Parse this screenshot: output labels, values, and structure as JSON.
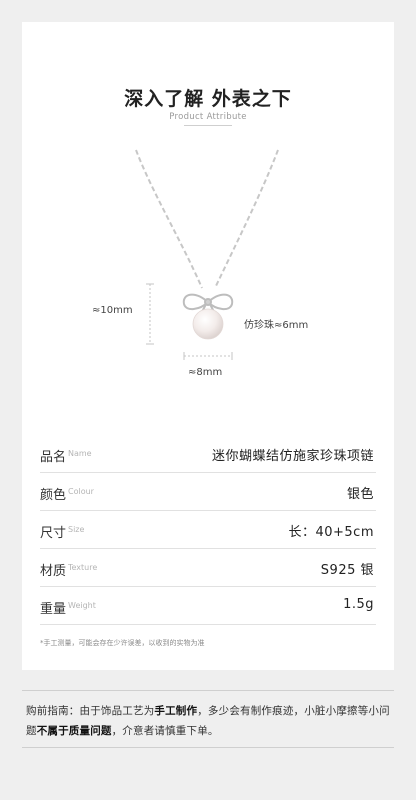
{
  "header": {
    "title": "深入了解 外表之下",
    "subtitle": "Product Attribute"
  },
  "dimensions": {
    "height_label": "≈10mm",
    "pearl_label": "仿珍珠≈6mm",
    "width_label": "≈8mm"
  },
  "attributes": [
    {
      "label": "品名",
      "label_en": "Name",
      "value": "迷你蝴蝶结仿施家珍珠项链"
    },
    {
      "label": "颜色",
      "label_en": "Colour",
      "value": "银色"
    },
    {
      "label": "尺寸",
      "label_en": "Size",
      "value": "长：40+5cm"
    },
    {
      "label": "材质",
      "label_en": "Texture",
      "value": "S925 银"
    },
    {
      "label": "重量",
      "label_en": "Weight",
      "value": "1.5g"
    }
  ],
  "footnote": "*手工测量，可能会存在少许误差，以收到的实物为准",
  "notice": {
    "part1": "购前指南：由于饰品工艺为",
    "bold1": "手工制作",
    "part2": "，多少会有制作痕迹，小脏小摩擦等小问题",
    "bold2": "不属于质量问题",
    "part3": "，介意者请慎重下单。"
  },
  "colors": {
    "background": "#efefef",
    "card": "#ffffff",
    "silver": "#c9c9c9",
    "pearl": "#f3ecea"
  }
}
